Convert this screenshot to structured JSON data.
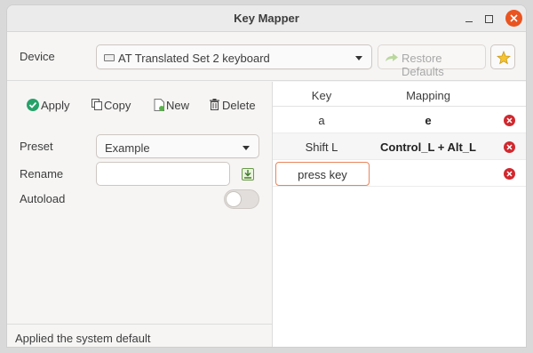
{
  "window": {
    "title": "Key Mapper"
  },
  "device": {
    "label": "Device",
    "selected": "AT Translated Set 2 keyboard",
    "restore_label": "Restore Defaults"
  },
  "toolbar": {
    "apply": "Apply",
    "copy": "Copy",
    "new": "New",
    "delete": "Delete"
  },
  "preset": {
    "label": "Preset",
    "selected": "Example"
  },
  "rename": {
    "label": "Rename",
    "value": ""
  },
  "autoload": {
    "label": "Autoload",
    "enabled": false
  },
  "status": {
    "text": "Applied the system default"
  },
  "table": {
    "headers": [
      "Key",
      "Mapping"
    ],
    "rows": [
      {
        "key": "a",
        "mapping": "e"
      },
      {
        "key": "Shift L",
        "mapping": "Control_L + Alt_L"
      },
      {
        "key": "press key",
        "mapping": ""
      }
    ]
  },
  "colors": {
    "accent": "#e95420",
    "apply_green": "#26a269",
    "delete_red": "#d0292f"
  }
}
